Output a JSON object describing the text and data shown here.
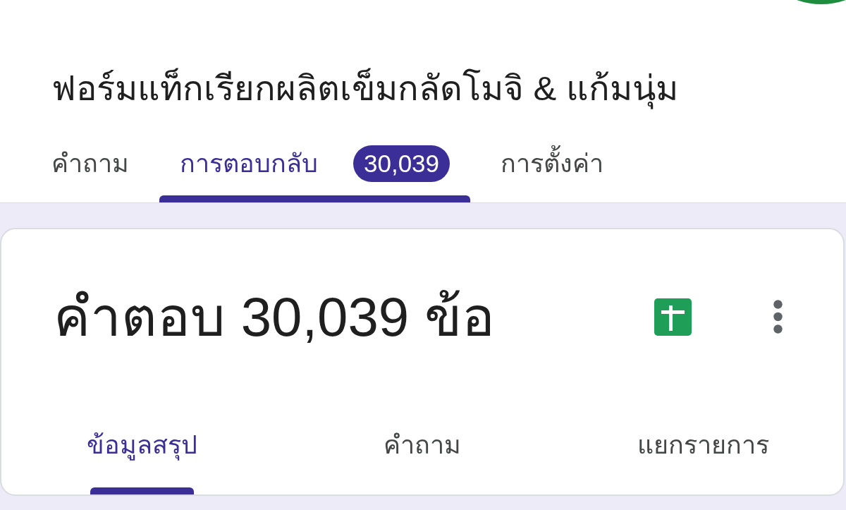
{
  "form": {
    "title": "ฟอร์มแท็กเรียกผลิตเข็มกลัดโมจิ & แก้มนุ่ม"
  },
  "tabs": [
    {
      "label": "คำถาม",
      "selected": false
    },
    {
      "label": "การตอบกลับ",
      "selected": true,
      "badge": "30,039"
    },
    {
      "label": "การตั้งค่า",
      "selected": false
    }
  ],
  "responses_card": {
    "heading": "คำตอบ 30,039 ข้อ",
    "subtabs": [
      {
        "label": "ข้อมูลสรุป",
        "selected": true
      },
      {
        "label": "คำถาม",
        "selected": false
      },
      {
        "label": "แยกรายการ",
        "selected": false
      }
    ]
  }
}
